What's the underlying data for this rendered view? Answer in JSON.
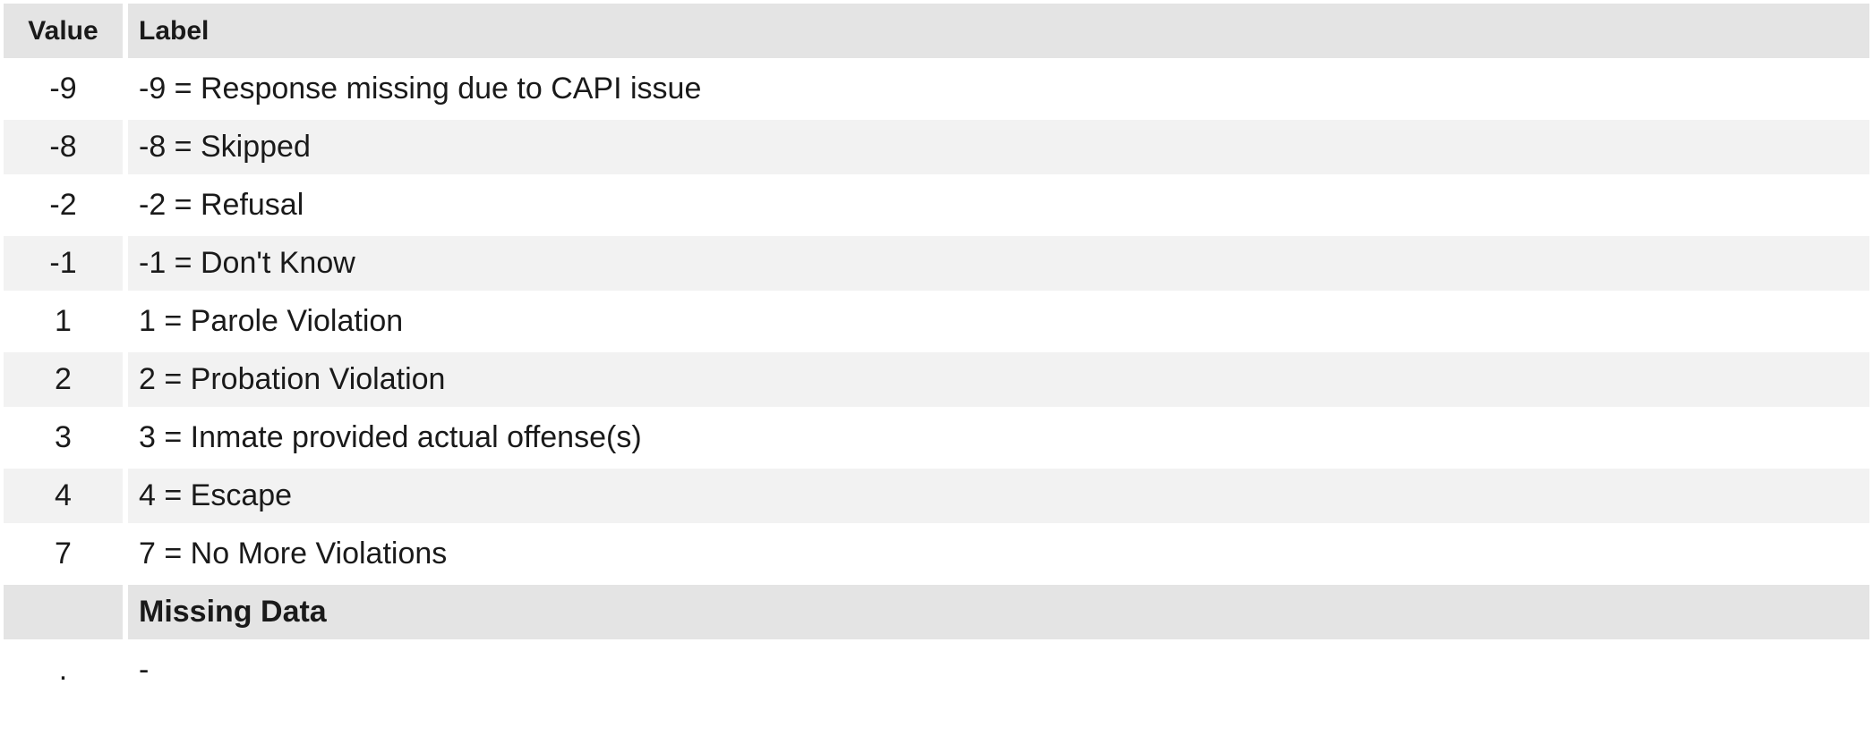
{
  "table": {
    "headers": {
      "value": "Value",
      "label": "Label"
    },
    "rows": [
      {
        "value": "-9",
        "label": "-9 = Response missing due to CAPI issue"
      },
      {
        "value": "-8",
        "label": "-8 = Skipped"
      },
      {
        "value": "-2",
        "label": "-2 = Refusal"
      },
      {
        "value": "-1",
        "label": "-1 = Don't Know"
      },
      {
        "value": "1",
        "label": "1 = Parole Violation"
      },
      {
        "value": "2",
        "label": "2 = Probation Violation"
      },
      {
        "value": "3",
        "label": "3 = Inmate provided actual offense(s)"
      },
      {
        "value": "4",
        "label": "4 = Escape"
      },
      {
        "value": "7",
        "label": "7 = No More Violations"
      }
    ],
    "missing_section": {
      "title": "Missing Data",
      "rows": [
        {
          "value": ".",
          "label": "-"
        }
      ]
    }
  }
}
